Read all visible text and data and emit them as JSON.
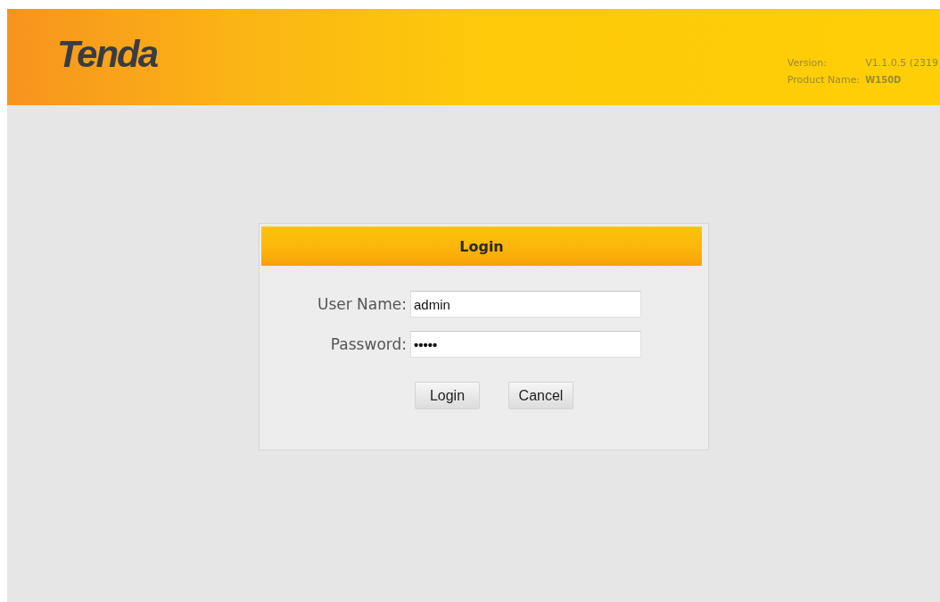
{
  "header": {
    "logo": "Tenda",
    "version_label": "Version:",
    "version_value": "V1.1.0.5 (2319",
    "product_label": "Product Name:",
    "product_value": "W150D"
  },
  "login_panel": {
    "title": "Login",
    "fields": [
      {
        "label": "User Name:",
        "value": "admin"
      },
      {
        "label": "Password:",
        "value": "•••••"
      }
    ],
    "buttons": [
      "Login",
      "Cancel"
    ]
  }
}
